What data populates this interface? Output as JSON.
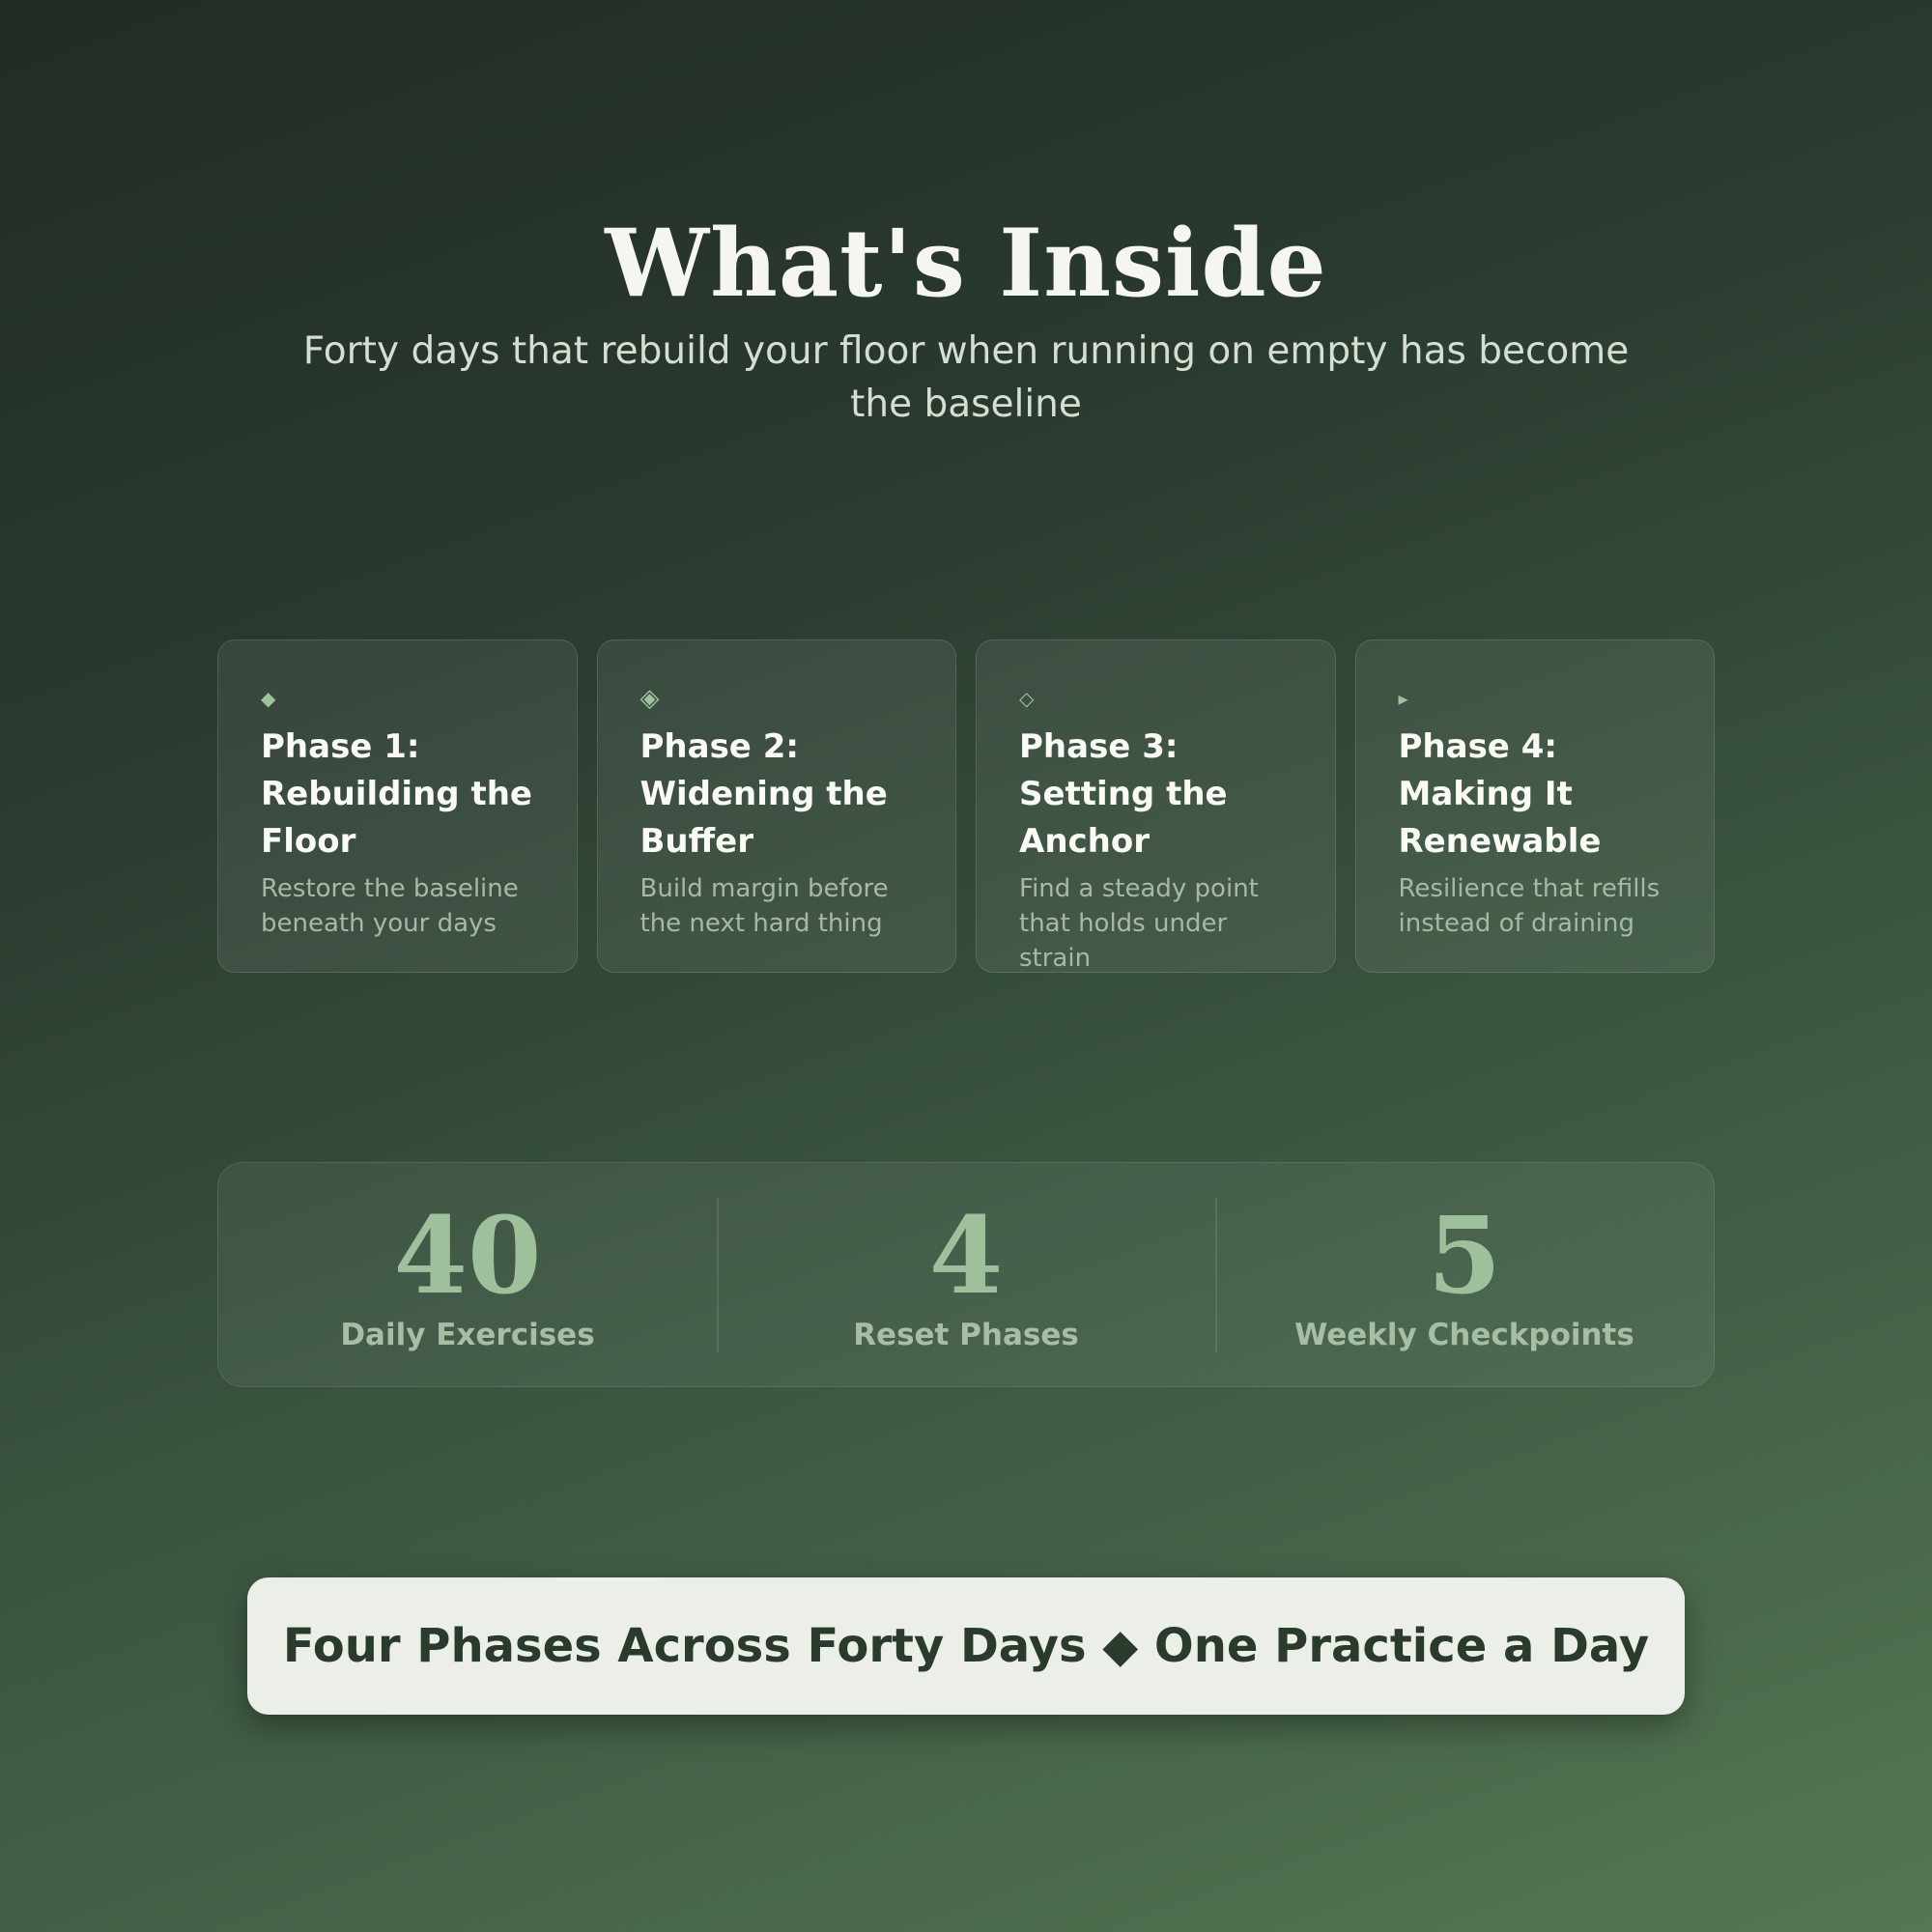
{
  "header": {
    "title": "What's Inside",
    "subtitle": "Forty days that rebuild your floor when running on empty has become the baseline"
  },
  "phases": [
    {
      "icon": "◆",
      "icon_name": "filled-diamond-icon",
      "title": "Phase 1: Rebuilding the Floor",
      "description": "Restore the baseline beneath your days"
    },
    {
      "icon": "◈",
      "icon_name": "diamond-in-diamond-icon",
      "title": "Phase 2: Widening the Buffer",
      "description": "Build margin before the next hard thing"
    },
    {
      "icon": "◇",
      "icon_name": "outline-diamond-icon",
      "title": "Phase 3: Setting the Anchor",
      "description": "Find a steady point that holds under strain"
    },
    {
      "icon": "▸",
      "icon_name": "play-triangle-icon",
      "title": "Phase 4: Making It Renewable",
      "description": "Resilience that refills instead of draining"
    }
  ],
  "stats": [
    {
      "number": "40",
      "label": "Daily Exercises"
    },
    {
      "number": "4",
      "label": "Reset Phases"
    },
    {
      "number": "5",
      "label": "Weekly Checkpoints"
    }
  ],
  "banner": {
    "text": "Four Phases Across Forty Days ◆ One Practice a Day"
  },
  "colors": {
    "background_top": "#222c24",
    "background_bottom": "#537852",
    "accent": "#9ec19c",
    "banner_bg": "#ebefe8",
    "banner_text": "#2a3a2c"
  }
}
